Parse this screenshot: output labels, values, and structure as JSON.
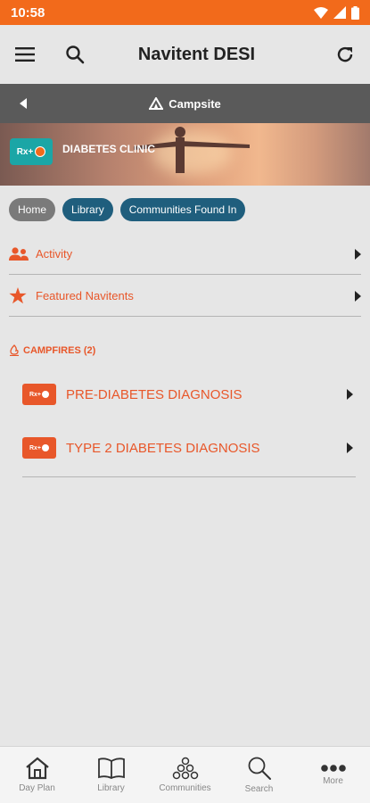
{
  "status_bar": {
    "time": "10:58"
  },
  "app_bar": {
    "title": "Navitent DESI"
  },
  "sub_bar": {
    "title": "Campsite"
  },
  "banner": {
    "name": "DIABETES CLINIC",
    "logo_text": "Rx+"
  },
  "chips": [
    {
      "label": "Home"
    },
    {
      "label": "Library"
    },
    {
      "label": "Communities Found In"
    }
  ],
  "menu": [
    {
      "label": "Activity",
      "icon": "people-icon"
    },
    {
      "label": "Featured Navitents",
      "icon": "star-icon"
    }
  ],
  "campfires": {
    "heading": "CAMPFIRES (2)",
    "items": [
      {
        "label": "PRE-DIABETES DIAGNOSIS",
        "logo_text": "Rx+"
      },
      {
        "label": "TYPE 2 DIABETES DIAGNOSIS",
        "logo_text": "Rx+"
      }
    ]
  },
  "bottom_nav": [
    {
      "label": "Day Plan",
      "icon": "home-icon"
    },
    {
      "label": "Library",
      "icon": "book-icon"
    },
    {
      "label": "Communities",
      "icon": "communities-icon"
    },
    {
      "label": "Search",
      "icon": "search-icon"
    },
    {
      "label": "More",
      "icon": "more-icon"
    }
  ],
  "colors": {
    "accent": "#f26a1b",
    "link": "#e8572a",
    "chip_blue": "#1f5e7d",
    "header_dark": "#5a5a5a"
  }
}
